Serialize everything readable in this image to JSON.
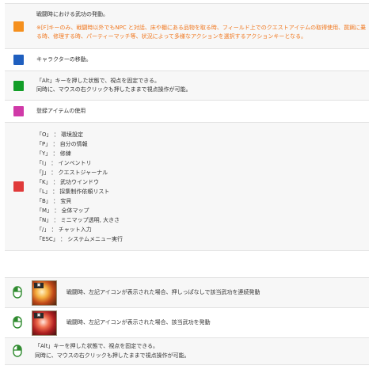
{
  "keyboard_rows": [
    {
      "color": "#f5901e",
      "text": "戦闘時における武功の発動。",
      "note": "※[F]キーのみ、戦闘時以外でもNPC と対話、床や棚にある品物を取る時、フィールド上でのクエストアイテムの取得使用、罠餌に乗る時、修理する時、パーティーマッチ等、状況によって多様なアクションを選択するアクションキーとなる。"
    },
    {
      "color": "#1f5fbf",
      "text": "キャラクターの移動。"
    },
    {
      "color": "#139e28",
      "lines": [
        "「Alt」キーを押した状態で、視点を固定できる。",
        "同時に、マウスの右クリックも押したままで視点操作が可能。"
      ]
    },
    {
      "color": "#d03aa8",
      "text": "登録アイテムの使用"
    },
    {
      "color": "#e03a3a",
      "lines": [
        "「O」 ： 環境設定",
        "「P」 ： 自分の情報",
        "「Y」 ： 修練",
        "「I」 ： インベントリ",
        "「J」 ： クエストジャーナル",
        "「K」 ： 武功ウインドウ",
        "「L」 ： 採集制作依頼リスト",
        "「B」 ： 宝貝",
        "「M」 ： 全体マップ",
        "「N」 ： ミニマップ透明, 大きさ",
        "「/」 ： チャット入力",
        "「ESC」 ： システムメニュー実行"
      ]
    }
  ],
  "mouse_rows": [
    {
      "mouse_icon": "mouse-left-click-icon",
      "skill_icon": "skill-fire-slash-icon",
      "text": "戦闘時、左記アイコンが表示された場合、押しっぱなしで該当武功を連続発動"
    },
    {
      "mouse_icon": "mouse-left-click-icon",
      "skill_icon": "skill-red-burst-icon",
      "text": "戦闘時、左記アイコンが表示された場合、該当武功を発動"
    },
    {
      "mouse_icon": "mouse-right-click-icon",
      "lines": [
        "「Alt」キーを押した状態で、視点を固定できる。",
        "同時に、マウスの右クリックも押したままで視点操作が可能。"
      ]
    }
  ]
}
